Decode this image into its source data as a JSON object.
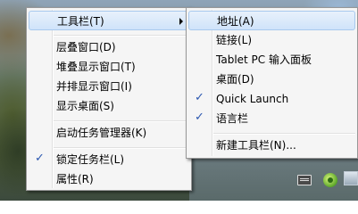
{
  "main_menu": {
    "items": [
      {
        "label": "工具栏(T)",
        "submenu": true,
        "highlighted": true
      },
      {
        "separator": true
      },
      {
        "label": "层叠窗口(D)"
      },
      {
        "label": "堆叠显示窗口(T)"
      },
      {
        "label": "并排显示窗口(I)"
      },
      {
        "label": "显示桌面(S)"
      },
      {
        "separator": true
      },
      {
        "label": "启动任务管理器(K)"
      },
      {
        "separator": true
      },
      {
        "label": "锁定任务栏(L)",
        "checked": true
      },
      {
        "label": "属性(R)"
      }
    ]
  },
  "toolbars_submenu": {
    "items": [
      {
        "label": "地址(A)",
        "highlighted": true
      },
      {
        "label": "链接(L)"
      },
      {
        "label": "Tablet PC 输入面板"
      },
      {
        "label": "桌面(D)"
      },
      {
        "label": "Quick Launch",
        "checked": true
      },
      {
        "label": "语言栏",
        "checked": true
      },
      {
        "separator": true
      },
      {
        "label": "新建工具栏(N)..."
      }
    ]
  },
  "check_glyph": "✓",
  "taskbar": {
    "icons": [
      "keyboard-icon",
      "app-icon",
      "network-icon"
    ]
  },
  "colors": {
    "menu_bg": "#f5f5f5",
    "highlight": "#cfe3fa",
    "check": "#2c58b0"
  }
}
